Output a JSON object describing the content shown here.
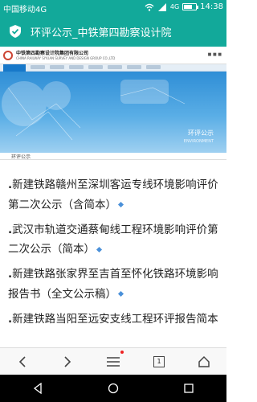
{
  "status_bar": {
    "carrier": "中国移动4G",
    "network": "4G",
    "time": "14:38"
  },
  "title_bar": {
    "title": "环评公示_中铁第四勘察设计院",
    "icon": "shield-check-icon",
    "color": "#12a99a"
  },
  "banner": {
    "org_name": "中铁第四勘察设计院集团有限公司",
    "org_name_en": "CHINA RAILWAY SIYUAN SURVEY AND DESIGN GROUP CO.,LTD",
    "label": "环评公示",
    "caption": "环评公示"
  },
  "articles": [
    {
      "title": "新建铁路赣州至深圳客运专线环境影响评价第二次公示（含简本）"
    },
    {
      "title": "武汉市轨道交通蔡甸线工程环境影响评价第二次公示（简本）"
    },
    {
      "title": "新建铁路张家界至吉首至怀化铁路环境影响报告书（全文公示稿）"
    },
    {
      "title": "新建铁路当阳至远安支线工程环评报告简本"
    }
  ],
  "browser_toolbar": {
    "back_icon": "chevron-left-icon",
    "forward_icon": "chevron-right-icon",
    "menu_icon": "hamburger-icon",
    "tab_count": "1",
    "home_icon": "home-icon"
  },
  "nav_bar": {
    "back_icon": "triangle-back-icon",
    "home_icon": "circle-home-icon",
    "recents_icon": "square-recents-icon"
  }
}
